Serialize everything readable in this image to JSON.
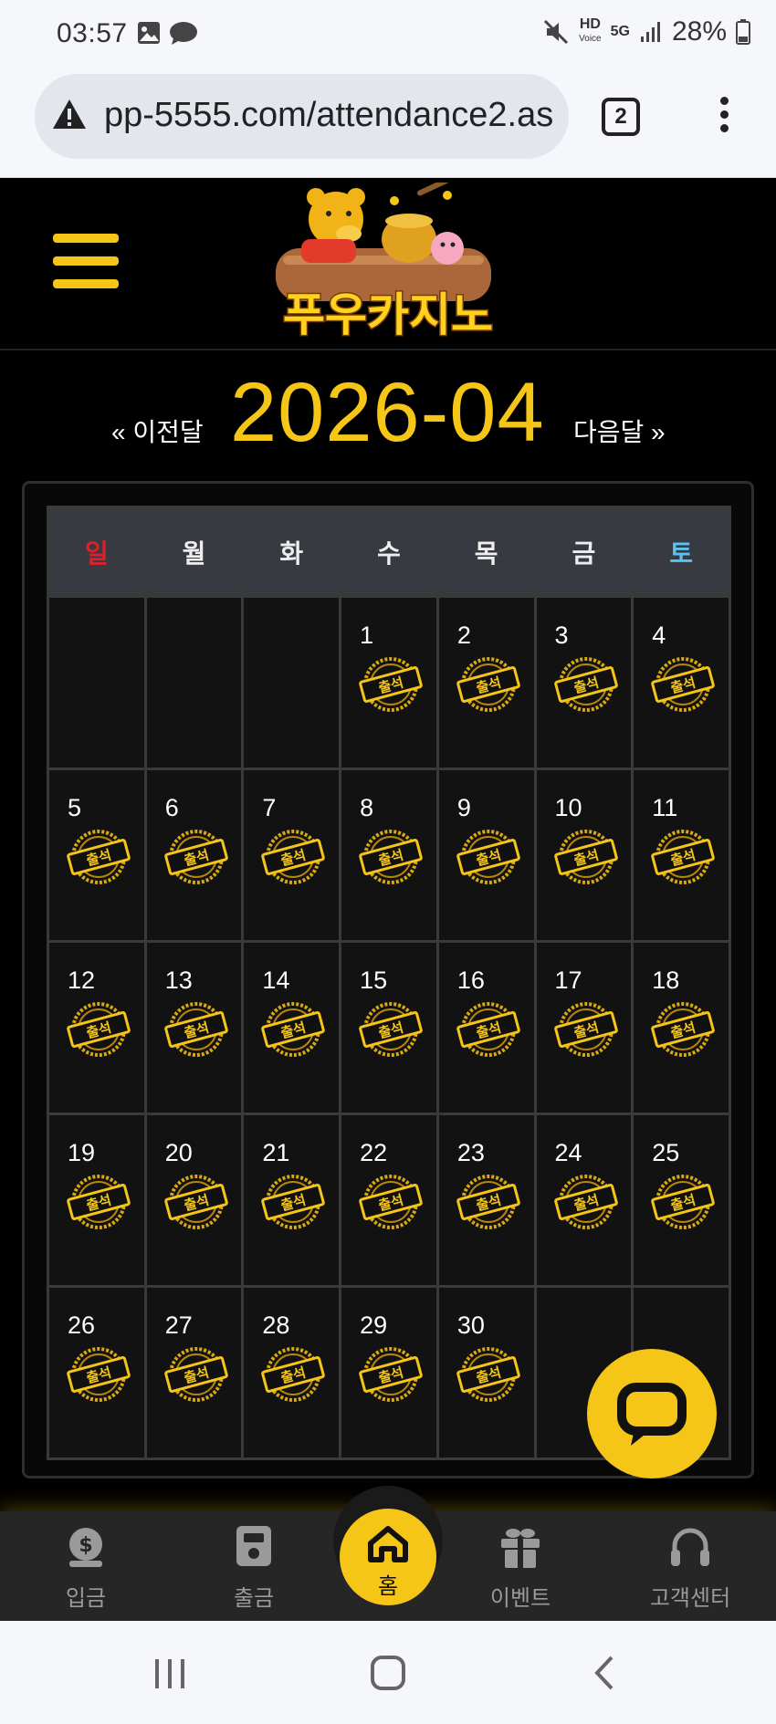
{
  "status_bar": {
    "time": "03:57",
    "hd": "HD",
    "voice": "Voice",
    "net": "5G",
    "battery": "28%"
  },
  "browser": {
    "url": "pp-5555.com/attendance2.as",
    "tab_count": "2"
  },
  "site": {
    "logo_text": "푸우카지노"
  },
  "month_nav": {
    "prev": "« 이전달",
    "title": "2026-04",
    "next": "다음달 »"
  },
  "calendar": {
    "weekdays": [
      "일",
      "월",
      "화",
      "수",
      "목",
      "금",
      "토"
    ],
    "weeks": [
      [
        "",
        "",
        "",
        "1",
        "2",
        "3",
        "4"
      ],
      [
        "5",
        "6",
        "7",
        "8",
        "9",
        "10",
        "11"
      ],
      [
        "12",
        "13",
        "14",
        "15",
        "16",
        "17",
        "18"
      ],
      [
        "19",
        "20",
        "21",
        "22",
        "23",
        "24",
        "25"
      ],
      [
        "26",
        "27",
        "28",
        "29",
        "30",
        "",
        ""
      ]
    ],
    "stamp_text": "출석"
  },
  "bottom_nav": {
    "deposit": "입금",
    "withdraw": "출금",
    "home": "홈",
    "event": "이벤트",
    "support": "고객센터"
  },
  "colors": {
    "accent": "#f5c518",
    "sunday": "#e41e26",
    "saturday": "#5ac2ee"
  }
}
